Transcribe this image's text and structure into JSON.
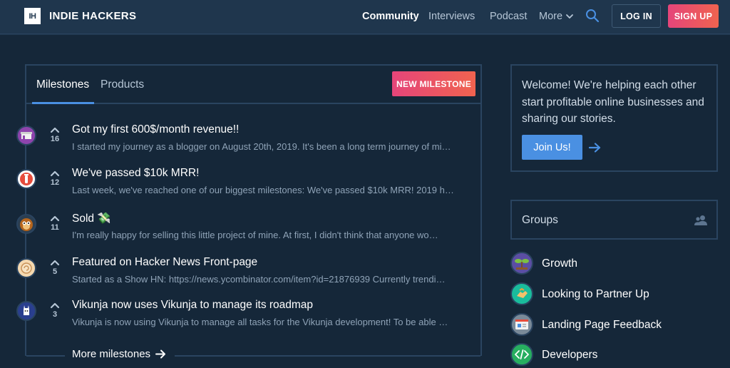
{
  "nav": {
    "logo_mark": "IH",
    "logo_text": "INDIE HACKERS",
    "links": [
      "Community",
      "Interviews",
      "Podcast",
      "More"
    ],
    "login": "LOG IN",
    "signup": "SIGN UP"
  },
  "milestones_panel": {
    "tabs": [
      "Milestones",
      "Products"
    ],
    "new_button": "NEW MILESTONE",
    "items": [
      {
        "votes": "16",
        "title": "Got my first 600$/month revenue!!",
        "excerpt": "I started my journey as a blogger on August 20th, 2019. It's been a long term journey of mi…"
      },
      {
        "votes": "12",
        "title": "We've passed $10k MRR!",
        "excerpt": "Last week, we've reached one of our biggest milestones: We've passed $10k MRR! 2019 h…"
      },
      {
        "votes": "11",
        "title": "Sold 💸",
        "excerpt": "I'm really happy for selling this little project of mine. At first, I didn't think that anyone wo…"
      },
      {
        "votes": "5",
        "title": "Featured on Hacker News Front-page",
        "excerpt": "Started as a Show HN: https://news.ycombinator.com/item?id=21876939 Currently trendi…"
      },
      {
        "votes": "3",
        "title": "Vikunja now uses Vikunja to manage its roadmap",
        "excerpt": "Vikunja is now using Vikunja to manage all tasks for the Vikunja development! To be able …"
      }
    ],
    "more_link": "More milestones"
  },
  "welcome": {
    "text": "Welcome! We're helping each other start profitable online businesses and sharing our stories.",
    "join_button": "Join Us!"
  },
  "groups": {
    "title": "Groups",
    "items": [
      "Growth",
      "Looking to Partner Up",
      "Landing Page Feedback",
      "Developers"
    ]
  },
  "colors": {
    "nav_bg": "#1f364d",
    "main_bg": "#152739",
    "border": "#2a4460",
    "accent_blue": "#4a90e2",
    "accent_pink": "#e5457a",
    "accent_orange": "#f0634f"
  }
}
